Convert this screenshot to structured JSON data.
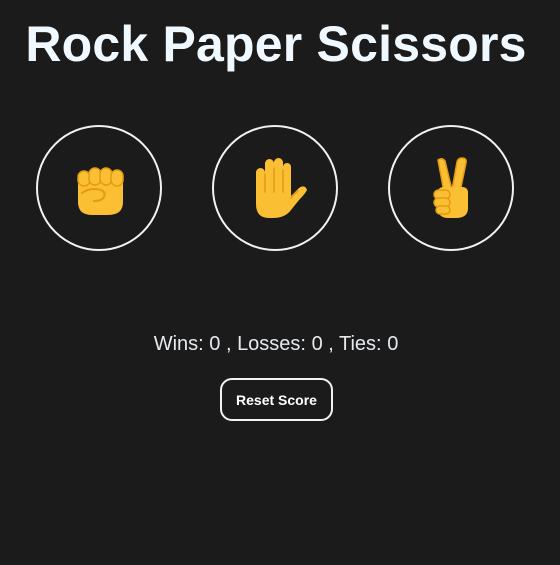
{
  "title": "Rock Paper Scissors",
  "choices": [
    {
      "name": "rock",
      "icon": "raised-fist-icon"
    },
    {
      "name": "paper",
      "icon": "raised-hand-icon"
    },
    {
      "name": "scissors",
      "icon": "victory-hand-icon"
    }
  ],
  "score": {
    "wins_label": "Wins:",
    "wins": "0",
    "losses_label": "Losses:",
    "losses": "0",
    "ties_label": "Ties:",
    "ties": "0",
    "separator": ","
  },
  "reset_label": "Reset Score",
  "colors": {
    "background": "#1b1b1b",
    "title": "#eff9ff",
    "circle_border": "#f2f2f2",
    "hand_fill": "#fbbf34",
    "hand_outline": "#e39b12"
  }
}
